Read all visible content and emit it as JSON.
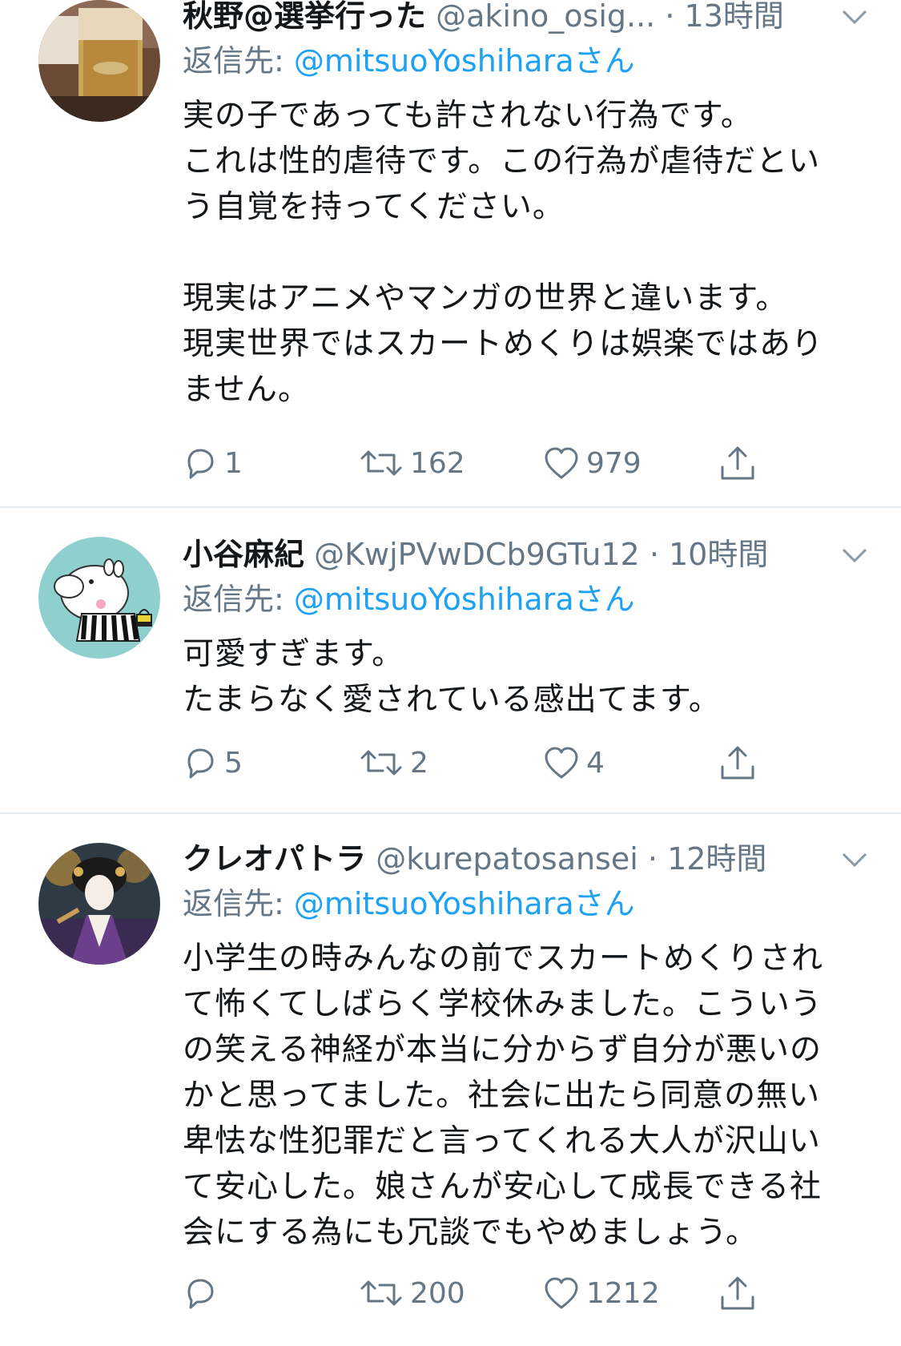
{
  "tweets": [
    {
      "name": "秋野@選挙行った",
      "handle": "@akino_osig...",
      "dot": "·",
      "time": "13時間",
      "reply_prefix": "返信先: ",
      "reply_mention": "@mitsuoYoshiharaさん",
      "text": "実の子であっても許されない行為です。\nこれは性的虐待です。この行為が虐待だとい\nう自覚を持ってください。\n\n現実はアニメやマンガの世界と違います。\n現実世界ではスカートめくりは娯楽ではあり\nません。",
      "replies": "1",
      "retweets": "162",
      "likes": "979",
      "avatar_icon": "beer-glass-avatar"
    },
    {
      "name": "小谷麻紀",
      "handle": "@KwjPVwDCb9GTu12",
      "dot": "·",
      "time": "10時間",
      "reply_prefix": "返信先: ",
      "reply_mention": "@mitsuoYoshiharaさん",
      "text": "可愛すぎます。\nたまらなく愛されている感出てます。",
      "replies": "5",
      "retweets": "2",
      "likes": "4",
      "avatar_icon": "moomin-avatar"
    },
    {
      "name": "クレオパトラ",
      "handle": "@kurepatosansei",
      "dot": "·",
      "time": "12時間",
      "reply_prefix": "返信先: ",
      "reply_mention": "@mitsuoYoshiharaさん",
      "text": "小学生の時みんなの前でスカートめくりされ\nて怖くてしばらく学校休みました。こういう\nの笑える神経が本当に分からず自分が悪いの\nかと思ってました。社会に出たら同意の無い\n卑怯な性犯罪だと言ってくれる大人が沢山い\nて安心した。娘さんが安心して成長できる社\n会にする為にも冗談でもやめましょう。",
      "replies": "",
      "retweets": "200",
      "likes": "1212",
      "avatar_icon": "geisha-avatar"
    }
  ],
  "colors": {
    "text": "#14171a",
    "secondary": "#657786",
    "link": "#1da1f2",
    "divider": "#e6ecf0"
  },
  "icons": {
    "reply": "reply-icon",
    "retweet": "retweet-icon",
    "like": "heart-icon",
    "share": "share-icon",
    "more": "chevron-down-icon"
  }
}
